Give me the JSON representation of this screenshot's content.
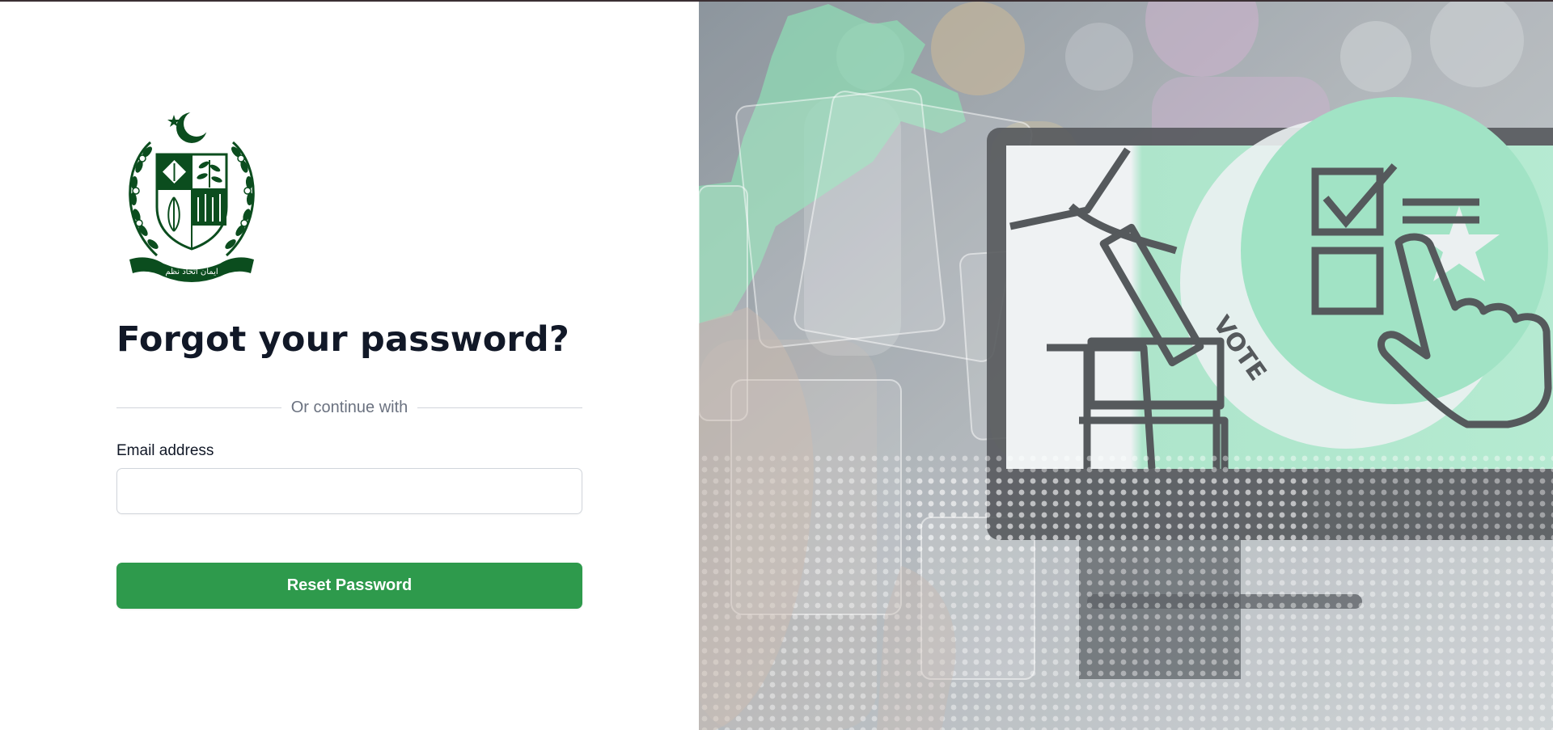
{
  "auth": {
    "title": "Forgot your password?",
    "divider_text": "Or continue with",
    "email_label": "Email address",
    "email_value": "",
    "email_placeholder": "",
    "submit_label": "Reset Password"
  },
  "emblem": {
    "icon": "state-emblem-icon",
    "motto": "ایمان اتحاد نظم"
  },
  "hero": {
    "icon": "voting-illustration",
    "ballot_text": "VOTE"
  },
  "colors": {
    "primary_button": "#2e9a4c",
    "emblem_green": "#0b4d1e",
    "title": "#111827",
    "muted_text": "#6b7280"
  }
}
